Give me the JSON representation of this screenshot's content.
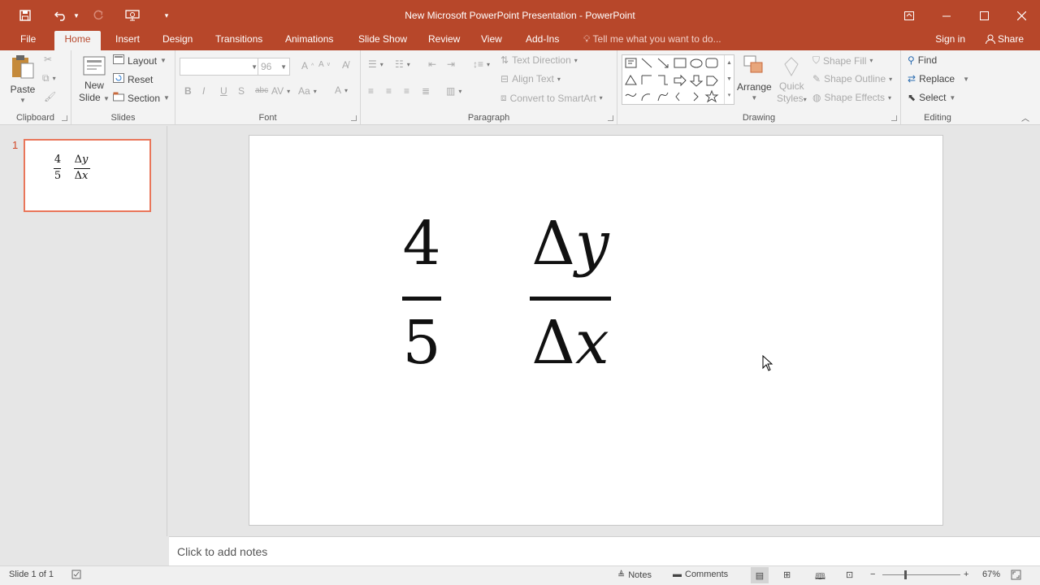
{
  "window": {
    "title": "New Microsoft PowerPoint Presentation - PowerPoint"
  },
  "tabs": {
    "file": "File",
    "home": "Home",
    "insert": "Insert",
    "design": "Design",
    "transitions": "Transitions",
    "animations": "Animations",
    "slide_show": "Slide Show",
    "review": "Review",
    "view": "View",
    "add_ins": "Add-Ins",
    "tell_me": "Tell me what you want to do...",
    "sign_in": "Sign in",
    "share": "Share"
  },
  "ribbon": {
    "clipboard": {
      "label": "Clipboard",
      "paste": "Paste"
    },
    "slides": {
      "label": "Slides",
      "new_slide_1": "New",
      "new_slide_2": "Slide",
      "layout": "Layout",
      "reset": "Reset",
      "section": "Section"
    },
    "font": {
      "label": "Font",
      "font_name": "",
      "font_size": "96"
    },
    "paragraph": {
      "label": "Paragraph",
      "text_direction": "Text Direction",
      "align_text": "Align Text",
      "convert_smartart": "Convert to SmartArt"
    },
    "drawing": {
      "label": "Drawing",
      "arrange": "Arrange",
      "quick_styles_1": "Quick",
      "quick_styles_2": "Styles",
      "shape_fill": "Shape Fill",
      "shape_outline": "Shape Outline",
      "shape_effects": "Shape Effects"
    },
    "editing": {
      "label": "Editing",
      "find": "Find",
      "replace": "Replace",
      "select": "Select"
    }
  },
  "slides_pane": {
    "slide_number": "1"
  },
  "slide": {
    "frac1_num": "4",
    "frac1_den": "5",
    "frac2_num": "Δ𝑦",
    "frac2_den": "Δ𝑥"
  },
  "notes": {
    "placeholder": "Click to add notes"
  },
  "status": {
    "slide_info": "Slide 1 of 1",
    "notes": "Notes",
    "comments": "Comments",
    "zoom": "67%"
  },
  "colors": {
    "accent": "#b7472a",
    "thumb_border": "#e9765a"
  }
}
